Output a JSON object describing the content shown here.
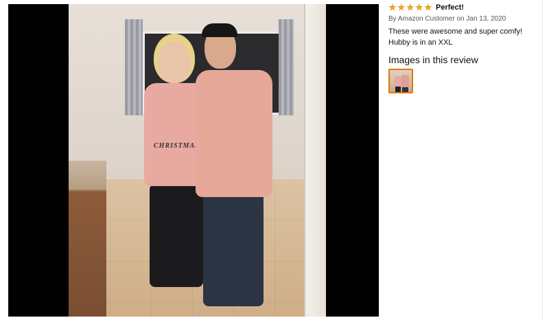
{
  "review": {
    "rating_stars": 5,
    "star_glyph": "★",
    "title": "Perfect!",
    "byline": "By Amazon Customer on Jan 13, 2020",
    "body": "These were awesome and super comfy! Hubby is in an XXL",
    "images_heading": "Images in this review"
  },
  "photo": {
    "sweater_text": "CHRISTMAS"
  },
  "colors": {
    "star": "#f0a81c",
    "thumb_border": "#e77600",
    "viewer_background": "#000000"
  }
}
